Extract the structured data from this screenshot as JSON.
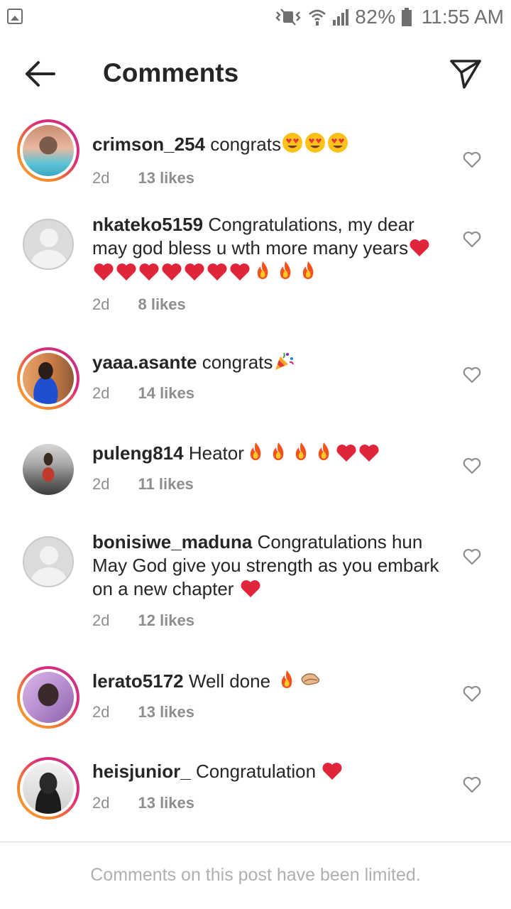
{
  "status_bar": {
    "battery": "82%",
    "time": "11:55 AM",
    "icons": [
      "image-icon",
      "mute-vibrate-icon",
      "wifi-icon",
      "signal-icon",
      "battery-icon"
    ]
  },
  "header": {
    "title": "Comments",
    "back_icon": "arrow-left-icon",
    "send_icon": "direct-send-icon"
  },
  "comments": [
    {
      "username": "crimson_254",
      "text": "congrats",
      "emojis": [
        "heart-eyes",
        "heart-eyes",
        "heart-eyes"
      ],
      "age": "2d",
      "likes": "13 likes",
      "story_ring": true
    },
    {
      "username": "nkateko5159",
      "text": "Congratulations, my dear may god bless u wth more many years",
      "emojis": [
        "red-heart",
        "red-heart",
        "red-heart",
        "red-heart",
        "red-heart",
        "red-heart",
        "red-heart",
        "red-heart",
        "fire",
        "fire",
        "fire"
      ],
      "age": "2d",
      "likes": "8 likes",
      "story_ring": false
    },
    {
      "username": "yaaa.asante",
      "text": "congrats",
      "emojis": [
        "party-popper"
      ],
      "age": "2d",
      "likes": "14 likes",
      "story_ring": true
    },
    {
      "username": "puleng814",
      "text": "Heator",
      "emojis": [
        "fire",
        "fire",
        "fire",
        "fire",
        "red-heart",
        "red-heart"
      ],
      "age": "2d",
      "likes": "11 likes",
      "story_ring": false
    },
    {
      "username": "bonisiwe_maduna",
      "text": "Congratulations hun May God give you strength as you embark on a new chapter",
      "emojis": [
        "red-heart"
      ],
      "age": "2d",
      "likes": "12 likes",
      "story_ring": false
    },
    {
      "username": "lerato5172",
      "text": "Well done",
      "emojis": [
        "fire",
        "clapping-hands"
      ],
      "age": "2d",
      "likes": "13 likes",
      "story_ring": true
    },
    {
      "username": "heisjunior_",
      "text": "Congratulation",
      "emojis": [
        "red-heart"
      ],
      "age": "2d",
      "likes": "13 likes",
      "story_ring": true
    }
  ],
  "footer": {
    "text": "Comments on this post have been limited."
  },
  "colors": {
    "text": "#262626",
    "muted": "#8e8e8e",
    "footer_text": "#b0b0b0",
    "story_ring_start": "#f9a23c",
    "story_ring_end": "#c13584"
  }
}
